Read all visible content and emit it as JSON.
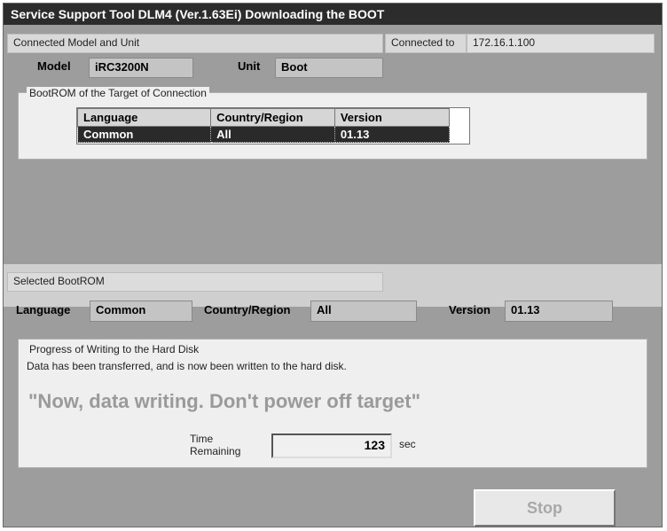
{
  "window": {
    "title": "Service Support Tool DLM4 (Ver.1.63Ei) Downloading the BOOT"
  },
  "connection": {
    "section_label": "Connected Model and Unit",
    "connected_to_label": "Connected to",
    "connected_to_value": "172.16.1.100",
    "model_label": "Model",
    "model_value": "iRC3200N",
    "unit_label": "Unit",
    "unit_value": "Boot"
  },
  "bootrom_target": {
    "group_label": "BootROM of the Target of Connection",
    "columns": [
      "Language",
      "Country/Region",
      "Version"
    ],
    "rows": [
      {
        "language": "Common",
        "country": "All",
        "version": "01.13"
      }
    ]
  },
  "selected": {
    "section_label": "Selected BootROM",
    "language_label": "Language",
    "language_value": "Common",
    "country_label": "Country/Region",
    "country_value": "All",
    "version_label": "Version",
    "version_value": "01.13"
  },
  "progress": {
    "group_label": "Progress of Writing to the Hard Disk",
    "message": "Data has been transferred, and is now been written to the hard disk.",
    "warning": "\"Now, data writing. Don't power off target\"",
    "time_label_line1": "Time",
    "time_label_line2": "Remaining",
    "time_value": "123",
    "time_unit": "sec"
  },
  "buttons": {
    "stop_label": "Stop"
  }
}
